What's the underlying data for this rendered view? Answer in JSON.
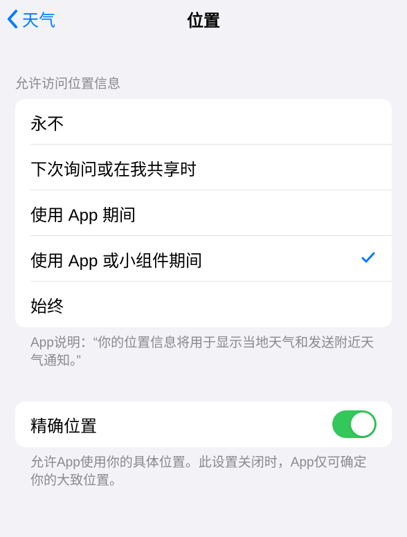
{
  "nav": {
    "back_label": "天气",
    "title": "位置"
  },
  "location_access": {
    "header": "允许访问位置信息",
    "options": [
      {
        "label": "永不",
        "selected": false
      },
      {
        "label": "下次询问或在我共享时",
        "selected": false
      },
      {
        "label": "使用 App 期间",
        "selected": false
      },
      {
        "label": "使用 App 或小组件期间",
        "selected": true
      },
      {
        "label": "始终",
        "selected": false
      }
    ],
    "footer": "App说明：“你的位置信息将用于显示当地天气和发送附近天气通知。”"
  },
  "precise": {
    "label": "精确位置",
    "enabled": true,
    "footer": "允许App使用你的具体位置。此设置关闭时，App仅可确定你的大致位置。"
  }
}
